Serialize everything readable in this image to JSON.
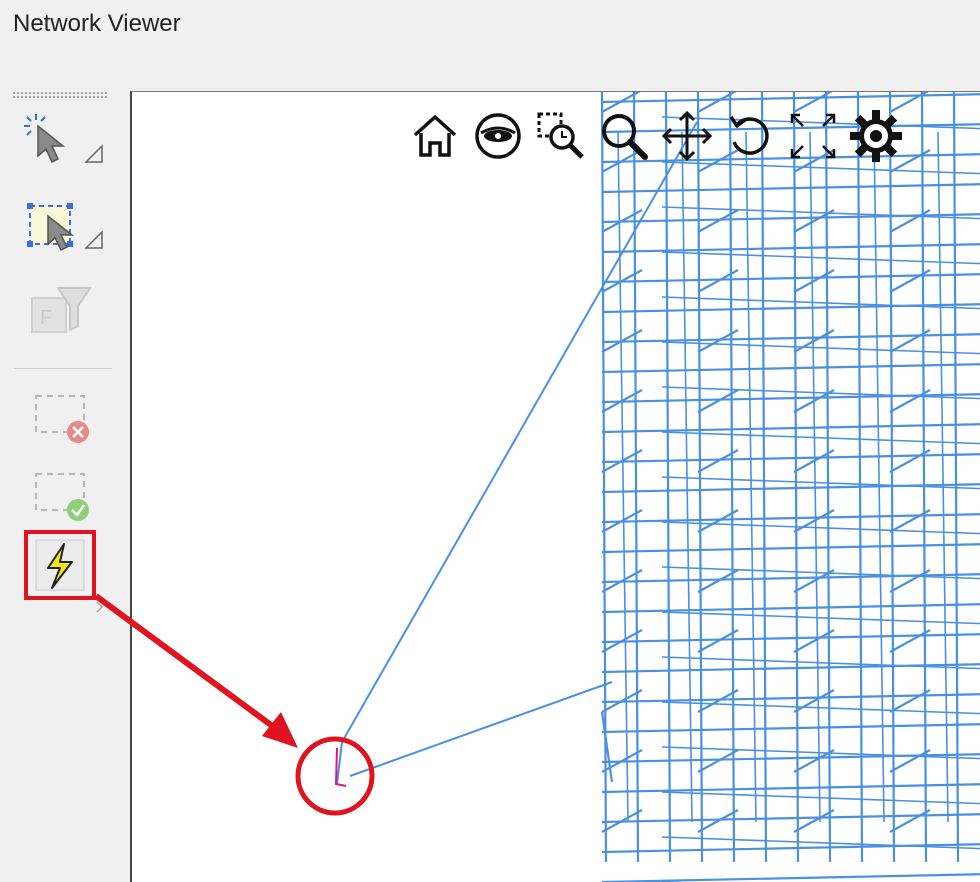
{
  "window": {
    "title": "Network Viewer"
  },
  "toolbar": {
    "buttons": [
      {
        "id": "select",
        "icon": "pointer-sparkle-icon",
        "enabled": true
      },
      {
        "id": "box-select",
        "icon": "box-select-icon",
        "enabled": true
      },
      {
        "id": "filter",
        "icon": "funnel-icon",
        "enabled": false
      },
      {
        "id": "clear-selection",
        "icon": "box-remove-icon",
        "enabled": false
      },
      {
        "id": "confirm-selection",
        "icon": "box-check-icon",
        "enabled": false
      },
      {
        "id": "run",
        "icon": "lightning-icon",
        "enabled": true,
        "highlighted": true
      }
    ]
  },
  "viewer_tools": [
    {
      "id": "home",
      "icon": "home-icon"
    },
    {
      "id": "view",
      "icon": "eye-icon"
    },
    {
      "id": "zoom-window",
      "icon": "zoom-window-icon"
    },
    {
      "id": "zoom",
      "icon": "magnifier-icon"
    },
    {
      "id": "pan",
      "icon": "move-arrows-icon"
    },
    {
      "id": "rotate",
      "icon": "rotate-icon"
    },
    {
      "id": "fit",
      "icon": "fit-view-icon"
    },
    {
      "id": "settings",
      "icon": "gear-icon"
    }
  ],
  "colors": {
    "mesh": "#4a90e2",
    "annotation": "#e0141e",
    "lightning": "#f3e61e",
    "highlight_segment": "#e0147a"
  }
}
